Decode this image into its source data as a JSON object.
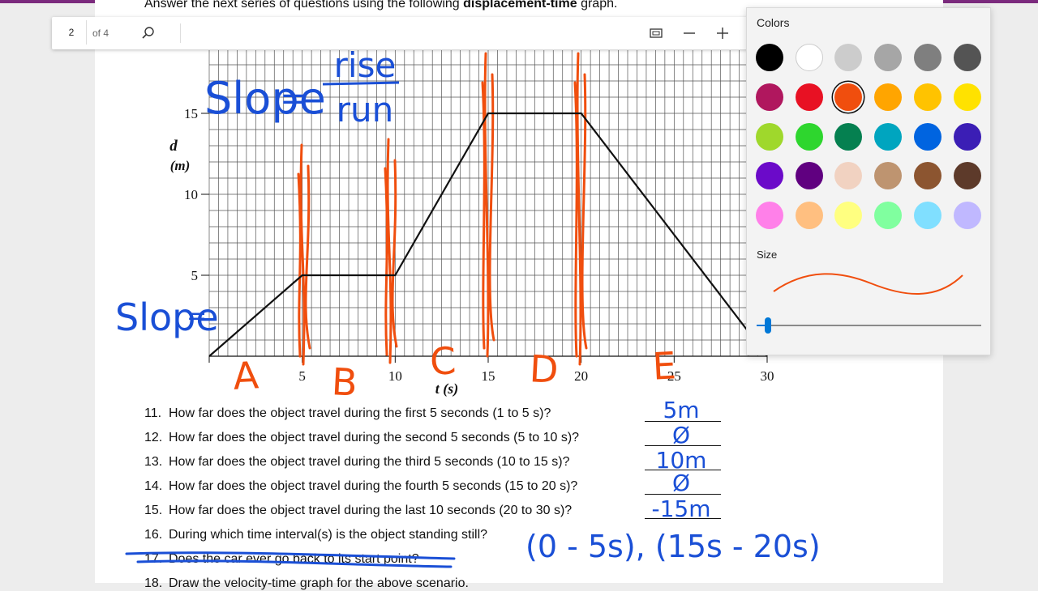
{
  "app": {
    "accent": "#7b2a7d"
  },
  "worksheet": {
    "intro_prefix": "Answer the next series of questions using the following",
    "intro_bold": "displacement-time",
    "intro_suffix": "graph."
  },
  "toolbar": {
    "page_number": "2",
    "page_of": "of 4",
    "icons": [
      "search-icon",
      "fit-page-icon",
      "zoom-out-icon",
      "zoom-in-icon"
    ]
  },
  "color_panel": {
    "title": "Colors",
    "size_label": "Size",
    "selected_color": "#f04e0e",
    "colors": [
      "#000000",
      "#ffffff",
      "#cccccc",
      "#a6a6a6",
      "#7f7f7f",
      "#545454",
      "#b0175e",
      "#e81123",
      "#f04e0e",
      "#ffa500",
      "#ffc300",
      "#ffe200",
      "#9fd82c",
      "#2ed62e",
      "#058050",
      "#00a5bf",
      "#0064e0",
      "#3b1eb5",
      "#6b0ac9",
      "#600080",
      "#f1d2c1",
      "#be9470",
      "#8c5530",
      "#5d3a2a",
      "#ff80e9",
      "#ffbf80",
      "#ffff80",
      "#80ff9f",
      "#80dfff",
      "#c0b8ff"
    ],
    "size_value": 0.05
  },
  "chart_data": {
    "type": "line",
    "xlabel": "t (s)",
    "ylabel_line1": "d",
    "ylabel_line2": "(m)",
    "x_ticks": [
      "5",
      "10",
      "15",
      "20",
      "25",
      "30"
    ],
    "y_ticks": [
      "5",
      "10",
      "15"
    ],
    "xlim": [
      0,
      30
    ],
    "ylim": [
      0,
      15
    ],
    "grid": true,
    "series": [
      {
        "x": [
          0,
          5,
          10,
          15,
          20,
          30
        ],
        "y": [
          0,
          5,
          5,
          15,
          15,
          0
        ]
      }
    ]
  },
  "annotations": {
    "slope_word": "Slope",
    "rise": "rise",
    "run": "run",
    "slope_short": "Slope",
    "eq": "=",
    "ink_blue": "#1a4fd6",
    "ink_orange": "#f04e0e",
    "interval_letters": [
      "A",
      "B",
      "C",
      "D",
      "E"
    ],
    "answers": [
      "5m",
      "Ø",
      "10m",
      "Ø",
      "-15m"
    ],
    "q16_answer": "(0 - 5s), (15s - 20s)"
  },
  "questions": [
    {
      "num": "11.",
      "text": "How far does the object travel during the first 5 seconds (1 to 5 s)?"
    },
    {
      "num": "12.",
      "text": "How far does the object travel during the second 5 seconds (5 to 10 s)?"
    },
    {
      "num": "13.",
      "text": "How far does the object travel during the third 5 seconds (10 to 15 s)?"
    },
    {
      "num": "14.",
      "text": "How far does the object travel during the fourth 5 seconds (15 to 20 s)?"
    },
    {
      "num": "15.",
      "text": "How far does the object travel during the last 10 seconds (20 to 30 s)?"
    },
    {
      "num": "16.",
      "text": "During which time interval(s) is the object standing still?"
    },
    {
      "num": "17.",
      "text": "Does the car ever go back to its start point?"
    },
    {
      "num": "18.",
      "text": "Draw the velocity-time graph for the above scenario."
    }
  ]
}
